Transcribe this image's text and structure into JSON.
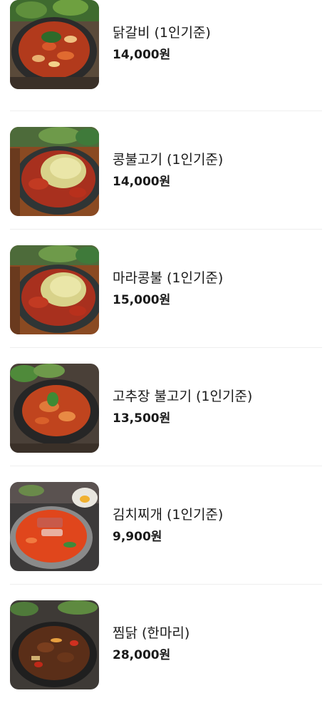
{
  "menu": {
    "items": [
      {
        "name": "닭갈비 (1인기준)",
        "price": "14,000",
        "currency": "원",
        "photo": "dakgalbi-photo"
      },
      {
        "name": "콩불고기 (1인기준)",
        "price": "14,000",
        "currency": "원",
        "photo": "kongbulgogi-photo"
      },
      {
        "name": "마라콩불 (1인기준)",
        "price": "15,000",
        "currency": "원",
        "photo": "marakongbul-photo"
      },
      {
        "name": "고추장 불고기 (1인기준)",
        "price": "13,500",
        "currency": "원",
        "photo": "gochujang-bulgogi-photo"
      },
      {
        "name": "김치찌개 (1인기준)",
        "price": "9,900",
        "currency": "원",
        "photo": "kimchi-jjigae-photo"
      },
      {
        "name": "찜닭 (한마리)",
        "price": "28,000",
        "currency": "원",
        "photo": "jjimdak-photo"
      }
    ]
  }
}
